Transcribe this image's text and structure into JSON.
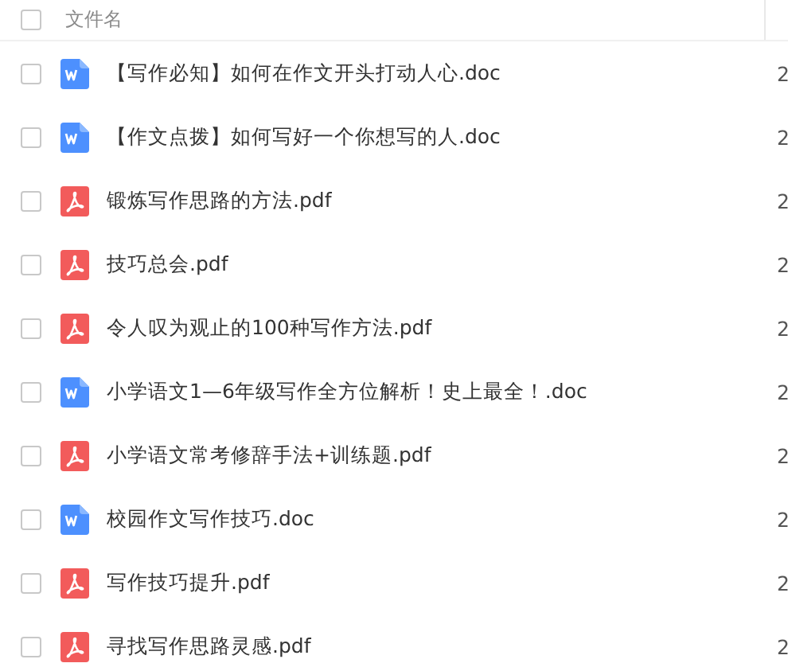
{
  "header": {
    "checked": false,
    "name_column": "文件名"
  },
  "files": [
    {
      "kind": "doc",
      "name": "【写作必知】如何在作文开头打动人心.doc",
      "column_2": "2",
      "checked": false
    },
    {
      "kind": "doc",
      "name": "【作文点拨】如何写好一个你想写的人.doc",
      "column_2": "2",
      "checked": false
    },
    {
      "kind": "pdf",
      "name": "锻炼写作思路的方法.pdf",
      "column_2": "2",
      "checked": false
    },
    {
      "kind": "pdf",
      "name": "技巧总会.pdf",
      "column_2": "2",
      "checked": false
    },
    {
      "kind": "pdf",
      "name": "令人叹为观止的100种写作方法.pdf",
      "column_2": "2",
      "checked": false
    },
    {
      "kind": "doc",
      "name": "小学语文1—6年级写作全方位解析！史上最全！.doc",
      "column_2": "2",
      "checked": false
    },
    {
      "kind": "pdf",
      "name": "小学语文常考修辞手法+训练题.pdf",
      "column_2": "2",
      "checked": false
    },
    {
      "kind": "doc",
      "name": "校园作文写作技巧.doc",
      "column_2": "2",
      "checked": false
    },
    {
      "kind": "pdf",
      "name": "写作技巧提升.pdf",
      "column_2": "2",
      "checked": false
    },
    {
      "kind": "pdf",
      "name": "寻找写作思路灵感.pdf",
      "column_2": "2",
      "checked": false
    }
  ]
}
